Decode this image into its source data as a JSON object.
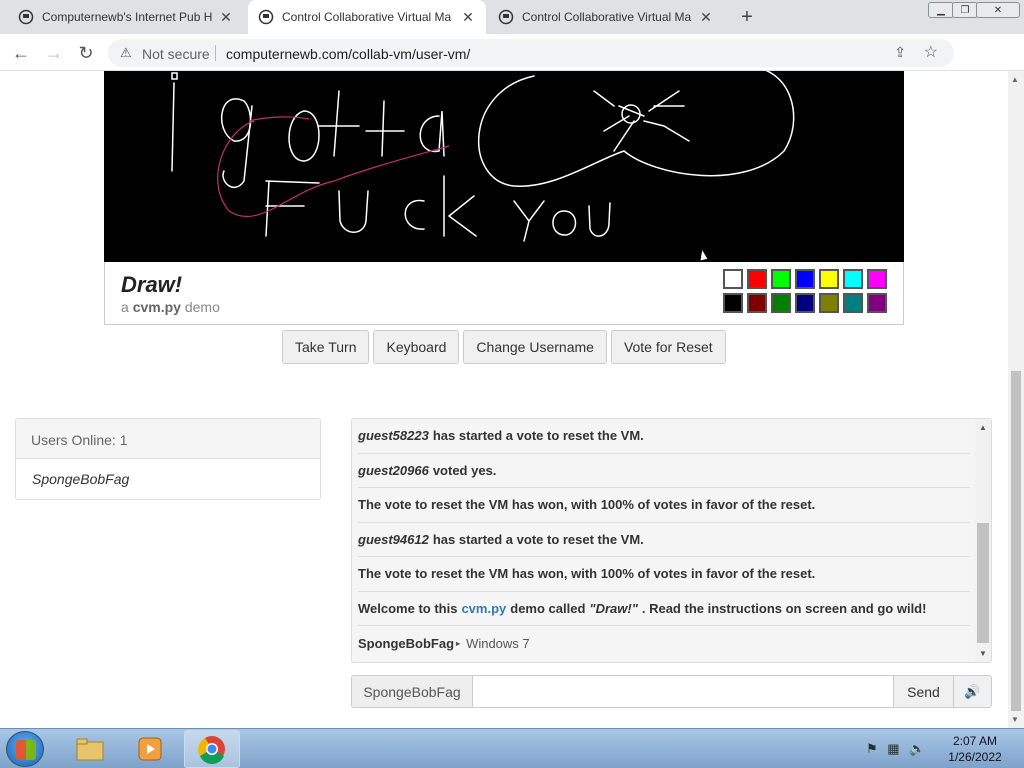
{
  "browser": {
    "tabs": [
      {
        "title": "Computernewb's Internet Pub Hu",
        "active": false
      },
      {
        "title": "Control Collaborative Virtual Ma",
        "active": true
      },
      {
        "title": "Control Collaborative Virtual Ma",
        "active": false
      }
    ],
    "security_label": "Not secure",
    "url": "computernewb.com/collab-vm/user-vm/"
  },
  "vm": {
    "title": "Draw!",
    "subtitle_prefix": "a",
    "subtitle_name": "cvm.py",
    "subtitle_suffix": "demo",
    "palette": [
      "#ffffff",
      "#ff0000",
      "#00ff00",
      "#0000ff",
      "#ffff00",
      "#00ffff",
      "#ff00ff",
      "#000000",
      "#800000",
      "#008000",
      "#000080",
      "#808000",
      "#008080",
      "#800080"
    ]
  },
  "actions": {
    "take_turn": "Take Turn",
    "keyboard": "Keyboard",
    "change_username": "Change Username",
    "vote_reset": "Vote for Reset"
  },
  "users": {
    "header": "Users Online: 1",
    "list": [
      "SpongeBobFag"
    ]
  },
  "chat": {
    "messages": [
      {
        "user": "guest58223",
        "text": "has started a vote to reset the VM."
      },
      {
        "user": "guest20966",
        "text": "voted yes."
      },
      {
        "text": "The vote to reset the VM has won, with 100% of votes in favor of the reset."
      },
      {
        "user": "guest94612",
        "text": "has started a vote to reset the VM."
      },
      {
        "text": "The vote to reset the VM has won, with 100% of votes in favor of the reset."
      },
      {
        "welcome_a": "Welcome to this",
        "welcome_link": "cvm.py",
        "welcome_b": "demo called",
        "welcome_quote": "\"Draw!\"",
        "welcome_c": ". Read the instructions on screen and go wild!"
      },
      {
        "user": "SpongeBobFag",
        "vm": "Windows 7"
      }
    ],
    "username": "SpongeBobFag",
    "send_label": "Send",
    "input_value": ""
  },
  "taskbar": {
    "time": "2:07 AM",
    "date": "1/26/2022"
  }
}
